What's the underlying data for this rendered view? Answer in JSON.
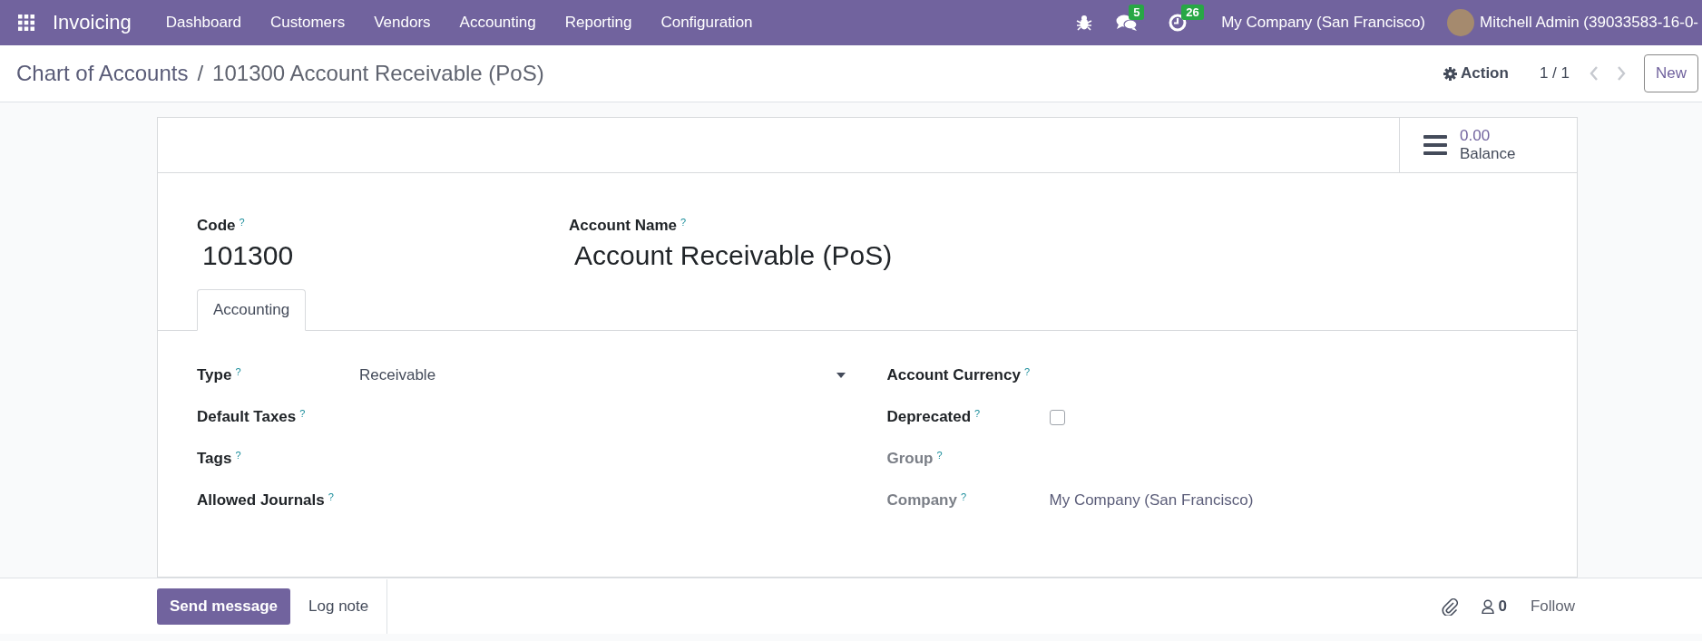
{
  "navbar": {
    "app_name": "Invoicing",
    "menu": [
      "Dashboard",
      "Customers",
      "Vendors",
      "Accounting",
      "Reporting",
      "Configuration"
    ],
    "messages_count": "5",
    "activities_count": "26",
    "company": "My Company (San Francisco)",
    "user": "Mitchell Admin (39033583-16-0-"
  },
  "control_panel": {
    "breadcrumbs": [
      "Chart of Accounts",
      "101300 Account Receivable (PoS)"
    ],
    "separator": "/",
    "action": "Action",
    "pager": "1 / 1",
    "new_button": "New"
  },
  "stat_button": {
    "value": "0.00",
    "label": "Balance"
  },
  "title_fields": [
    {
      "label": "Code",
      "help": "?",
      "value": "101300"
    },
    {
      "label": "Account Name",
      "help": "?",
      "value": "Account Receivable (PoS)"
    }
  ],
  "tabs": [
    {
      "label": "Accounting",
      "selected": true
    }
  ],
  "left_fields": [
    {
      "kind": "select",
      "label": "Type",
      "help": "?",
      "value": "Receivable",
      "readonly": false
    },
    {
      "kind": "empty",
      "label": "Default Taxes",
      "help": "?",
      "readonly": false
    },
    {
      "kind": "empty",
      "label": "Tags",
      "help": "?",
      "readonly": false
    },
    {
      "kind": "empty",
      "label": "Allowed Journals",
      "help": "?",
      "readonly": false
    }
  ],
  "right_fields": [
    {
      "kind": "empty",
      "label": "Account Currency",
      "help": "?",
      "readonly": false
    },
    {
      "kind": "checkbox",
      "label": "Deprecated",
      "help": "?",
      "checked": false,
      "readonly": false
    },
    {
      "kind": "empty",
      "label": "Group",
      "help": "?",
      "readonly": true
    },
    {
      "kind": "text",
      "label": "Company",
      "help": "?",
      "value": "My Company (San Francisco)",
      "readonly": true
    }
  ],
  "chatter": {
    "send_message": "Send message",
    "log_note": "Log note",
    "followers_count": "0",
    "follow": "Follow"
  }
}
